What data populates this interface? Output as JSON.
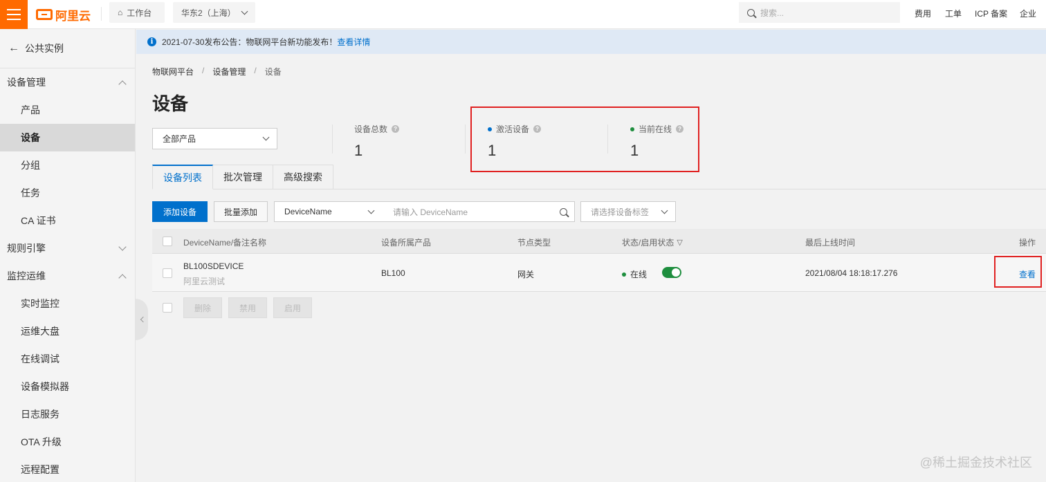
{
  "header": {
    "logo_text": "阿里云",
    "workbench": "工作台",
    "region": "华东2（上海）",
    "search_placeholder": "搜索...",
    "links": [
      "费用",
      "工单",
      "ICP 备案",
      "企业"
    ]
  },
  "sidebar": {
    "back_label": "公共实例",
    "groups": [
      {
        "label": "设备管理",
        "expanded": true,
        "items": [
          "产品",
          "设备",
          "分组",
          "任务",
          "CA 证书"
        ]
      },
      {
        "label": "规则引擎",
        "expanded": false,
        "items": []
      },
      {
        "label": "监控运维",
        "expanded": true,
        "items": [
          "实时监控",
          "运维大盘",
          "在线调试",
          "设备模拟器",
          "日志服务",
          "OTA 升级",
          "远程配置"
        ]
      }
    ],
    "active_item": "设备"
  },
  "notice": {
    "text": "2021-07-30发布公告：物联网平台新功能发布！",
    "link": "查看详情"
  },
  "breadcrumb": [
    "物联网平台",
    "设备管理",
    "设备"
  ],
  "page_title": "设备",
  "product_select": "全部产品",
  "stats": [
    {
      "label": "设备总数",
      "value": "1"
    },
    {
      "label": "激活设备",
      "value": "1",
      "dot_color": "#0070cc"
    },
    {
      "label": "当前在线",
      "value": "1",
      "dot_color": "#1e8e3e"
    }
  ],
  "tabs": [
    "设备列表",
    "批次管理",
    "高级搜索"
  ],
  "toolbar": {
    "add_button": "添加设备",
    "batch_add_button": "批量添加",
    "field_select": "DeviceName",
    "search_placeholder": "请输入 DeviceName",
    "tag_select": "请选择设备标签"
  },
  "table": {
    "headers": [
      "DeviceName/备注名称",
      "设备所属产品",
      "节点类型",
      "状态/启用状态",
      "最后上线时间",
      "操作"
    ],
    "rows": [
      {
        "device_name": "BL100SDEVICE",
        "remark": "阿里云测试",
        "product": "BL100",
        "node_type": "网关",
        "status": "在线",
        "enabled": true,
        "last_online": "2021/08/04 18:18:17.276",
        "action": "查看"
      }
    ],
    "bulk_buttons": [
      "删除",
      "禁用",
      "启用"
    ]
  },
  "watermark": "@稀土掘金技术社区",
  "colors": {
    "brand": "#ff6a00",
    "primary": "#0070cc",
    "online": "#1e8e3e",
    "highlight": "#e02020"
  }
}
